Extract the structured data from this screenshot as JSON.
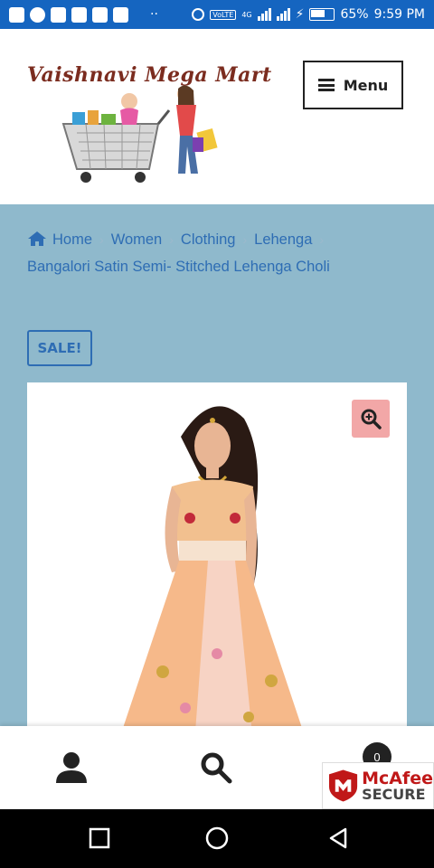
{
  "status_bar": {
    "battery": "65%",
    "time": "9:59 PM",
    "network": "VoLTE",
    "network_gen": "4G"
  },
  "header": {
    "logo_text": "Vaishnavi Mega Mart",
    "menu_label": "Menu"
  },
  "breadcrumb": {
    "items": [
      "Home",
      "Women",
      "Clothing",
      "Lehenga"
    ],
    "current": "Bangalori Satin Semi- Stitched Lehenga Choli"
  },
  "product": {
    "badge": "SALE!"
  },
  "bottom_nav": {
    "cart_count": "0",
    "badge_brand": "McAfee",
    "badge_word": "SECURE"
  },
  "colors": {
    "status_bar": "#1565c0",
    "page_bg": "#8fb9cc",
    "link": "#2e6db4",
    "zoom_bg": "#f2a7a7",
    "mcafee_red": "#c01818"
  },
  "icons": [
    "home-icon",
    "search-icon",
    "user-icon",
    "zoom-icon",
    "hamburger-icon"
  ]
}
